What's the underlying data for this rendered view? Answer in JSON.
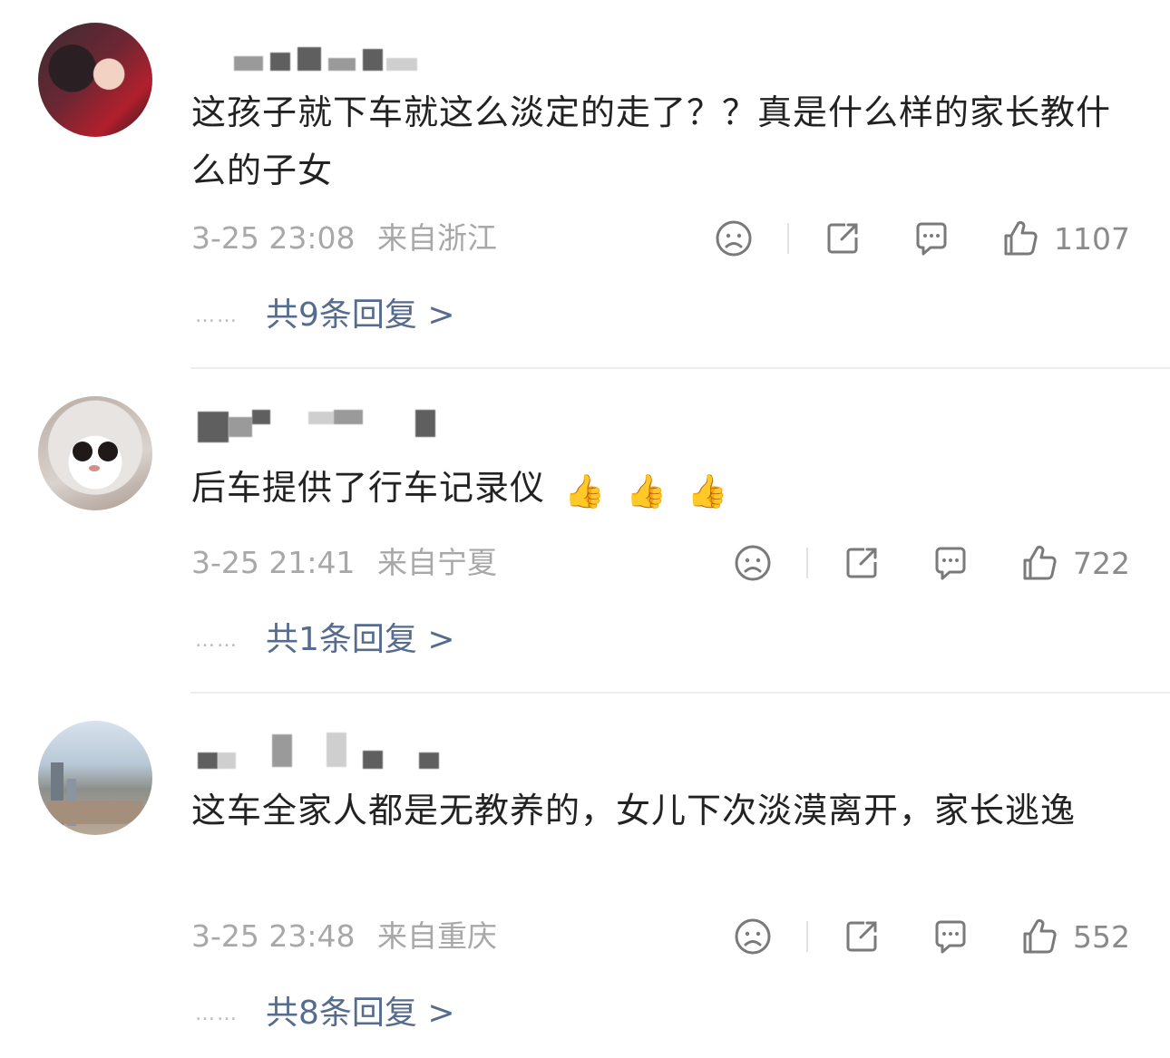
{
  "comments": [
    {
      "text": "这孩子就下车就这么淡定的走了？？真是什么样的家长教什么的子女",
      "time": "3-25 23:08",
      "location": "来自浙江",
      "likes": "1107",
      "replies": "共9条回复 >",
      "avatar_icon": "girl-with-dog-avatar"
    },
    {
      "text": "后车提供了行车记录仪",
      "emoji": [
        "👍",
        "👍",
        "👍"
      ],
      "time": "3-25 21:41",
      "location": "来自宁夏",
      "likes": "722",
      "replies": "共1条回复 >",
      "avatar_icon": "white-cat-avatar"
    },
    {
      "text": "这车全家人都是无教养的，女儿下次淡漠离开，家长逃逸",
      "time": "3-25 23:48",
      "location": "来自重庆",
      "likes": "552",
      "replies": "共8条回复 >",
      "avatar_icon": "city-construction-avatar"
    }
  ],
  "ui": {
    "reply_dots": "……",
    "icons": [
      "dislike-face-icon",
      "share-icon",
      "comment-icon",
      "like-icon"
    ],
    "colors": {
      "text": "#222222",
      "meta": "#a8a8a8",
      "reply_link": "#566c8f"
    }
  }
}
